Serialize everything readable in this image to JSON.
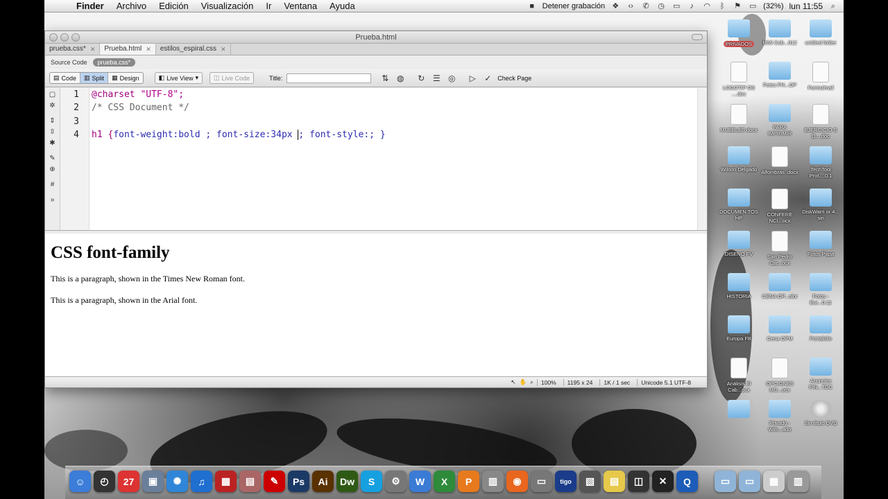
{
  "menubar": {
    "apple": "",
    "items": [
      "Finder",
      "Archivo",
      "Edición",
      "Visualización",
      "Ir",
      "Ventana",
      "Ayuda"
    ],
    "recording": "Detener grabación",
    "battery": "(32%)",
    "clock": "lun 11:55"
  },
  "window": {
    "title": "Prueba.html",
    "tabs": [
      {
        "label": "prueba.css*"
      },
      {
        "label": "Prueba.html"
      },
      {
        "label": "estilos_espiral.css"
      }
    ],
    "related": {
      "source_label": "Source Code",
      "file_pill": "prueba.css*"
    },
    "toolbar": {
      "code": "Code",
      "split": "Split",
      "design": "Design",
      "live_view": "Live View",
      "live_code": "Live Code",
      "title_label": "Title:",
      "check_page": "Check Page"
    },
    "code": {
      "line_numbers": [
        "1",
        "2",
        "3",
        "4"
      ],
      "l1_kw": "@charset",
      "l1_str": " \"UTF-8\";",
      "l2": "/* CSS Document */",
      "l4_sel": "h1 {",
      "l4_p1": "font-weight:bold ; font-size:34px ",
      "l4_p2": "; font-style:; }"
    },
    "design": {
      "heading": "CSS font-family",
      "p1": "This is a paragraph, shown in the Times New Roman font.",
      "p2": "This is a paragraph, shown in the Arial font."
    },
    "status": {
      "zoom": "100%",
      "dims": "1195 x 24",
      "size": "1K / 1 sec",
      "encoding": "Unicode 5.1 UTF-8"
    }
  },
  "desktop_icons": [
    {
      "label": "PRIVADOS",
      "type": "folder"
    },
    {
      "label": "MMI Cob...012",
      "type": "folder"
    },
    {
      "label": "untitled folder",
      "type": "folder"
    },
    {
      "label": "LOGOTIP OS ....doc",
      "type": "doc"
    },
    {
      "label": "Fotos PH...OP",
      "type": "folder"
    },
    {
      "label": "Formulmail",
      "type": "doc"
    },
    {
      "label": "MUEBLES docx",
      "type": "doc"
    },
    {
      "label": "PARA IMPRIMIR",
      "type": "folder"
    },
    {
      "label": "EJERCICIO S D....doc",
      "type": "doc"
    },
    {
      "label": "Wilson Delgado",
      "type": "folder"
    },
    {
      "label": "Alfombras .docx",
      "type": "doc"
    },
    {
      "label": "TechTool Prot....0.1",
      "type": "folder"
    },
    {
      "label": "DOCUMEN TOS HP",
      "type": "folder"
    },
    {
      "label": "CONFERE NCI...ocx",
      "type": "doc"
    },
    {
      "label": "DiskWarri or 4... sin",
      "type": "folder"
    },
    {
      "label": "DISENO FV",
      "type": "folder"
    },
    {
      "label": "San Pedro Car...ocx",
      "type": "doc"
    },
    {
      "label": "Fotos Papa",
      "type": "folder"
    },
    {
      "label": "HISTORIA",
      "type": "folder"
    },
    {
      "label": "CENA OP...olor",
      "type": "folder"
    },
    {
      "label": "Fotos - Eur...0.11",
      "type": "folder"
    },
    {
      "label": "Europa FB",
      "type": "folder"
    },
    {
      "label": "Cena OPM",
      "type": "folder"
    },
    {
      "label": "Portafolio",
      "type": "folder"
    },
    {
      "label": "Análisis El Cab...ocx",
      "type": "doc"
    },
    {
      "label": "OPCIONES MU...ocx",
      "type": "doc"
    },
    {
      "label": "Anuncios FIN...TDC",
      "type": "folder"
    },
    {
      "label": "",
      "type": "folder"
    },
    {
      "label": "Privado - Wils...ado",
      "type": "folder"
    },
    {
      "label": "Sin título DVD",
      "type": "dvd"
    }
  ],
  "dock": [
    {
      "name": "finder-icon",
      "glyph": "☺",
      "color": "#3b7dd8"
    },
    {
      "name": "dashboard-icon",
      "glyph": "◴",
      "color": "#333"
    },
    {
      "name": "calendar-icon",
      "glyph": "27",
      "color": "#d33"
    },
    {
      "name": "preview-icon",
      "glyph": "▣",
      "color": "#6a7f99"
    },
    {
      "name": "safari-icon",
      "glyph": "✺",
      "color": "#2f86d8"
    },
    {
      "name": "itunes-icon",
      "glyph": "♫",
      "color": "#1f6fd1"
    },
    {
      "name": "photo-booth-icon",
      "glyph": "▦",
      "color": "#b22"
    },
    {
      "name": "iphoto-icon",
      "glyph": "▤",
      "color": "#a66"
    },
    {
      "name": "acrobat-icon",
      "glyph": "✎",
      "color": "#c00"
    },
    {
      "name": "photoshop-icon",
      "glyph": "Ps",
      "color": "#1b3a66"
    },
    {
      "name": "illustrator-icon",
      "glyph": "Ai",
      "color": "#5a3100"
    },
    {
      "name": "dreamweaver-icon",
      "glyph": "Dw",
      "color": "#2e5a15"
    },
    {
      "name": "skype-icon",
      "glyph": "S",
      "color": "#16a0e0"
    },
    {
      "name": "preferences-icon",
      "glyph": "⚙",
      "color": "#777"
    },
    {
      "name": "word-icon",
      "glyph": "W",
      "color": "#3a7bd5"
    },
    {
      "name": "excel-icon",
      "glyph": "X",
      "color": "#2e8b3a"
    },
    {
      "name": "powerpoint-icon",
      "glyph": "P",
      "color": "#e87a1e"
    },
    {
      "name": "utility-icon",
      "glyph": "▥",
      "color": "#888"
    },
    {
      "name": "firefox-icon",
      "glyph": "◉",
      "color": "#e8661e"
    },
    {
      "name": "app-icon-1",
      "glyph": "▭",
      "color": "#777"
    },
    {
      "name": "tigo-icon",
      "glyph": "tigo",
      "color": "#1a3c8a"
    },
    {
      "name": "app-icon-2",
      "glyph": "▧",
      "color": "#555"
    },
    {
      "name": "stickies-icon",
      "glyph": "▤",
      "color": "#e6c84a"
    },
    {
      "name": "activity-monitor-icon",
      "glyph": "◫",
      "color": "#333"
    },
    {
      "name": "app-icon-3",
      "glyph": "✕",
      "color": "#222"
    },
    {
      "name": "quicktime-icon",
      "glyph": "Q",
      "color": "#1d5cb8"
    },
    {
      "name": "applications-folder-icon",
      "glyph": "▭",
      "color": "#8fb4d8"
    },
    {
      "name": "documents-folder-icon",
      "glyph": "▭",
      "color": "#8fb4d8"
    },
    {
      "name": "downloads-icon",
      "glyph": "▦",
      "color": "#ccc"
    },
    {
      "name": "trash-icon",
      "glyph": "▥",
      "color": "#999"
    }
  ]
}
